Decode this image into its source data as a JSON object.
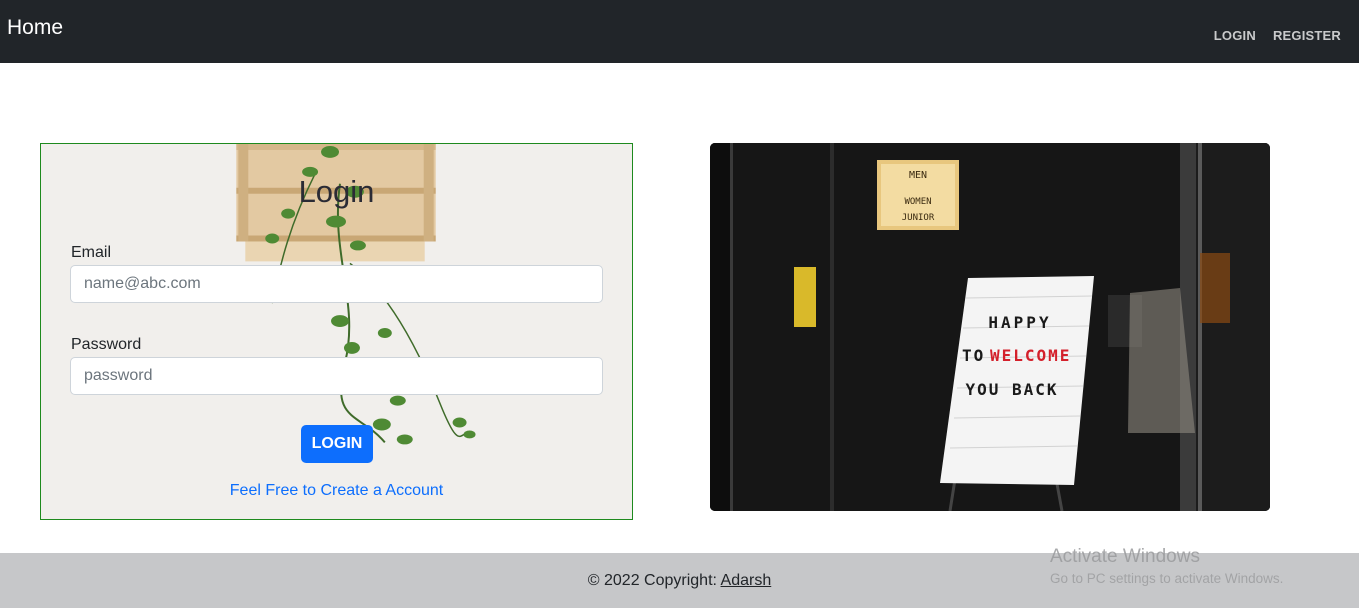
{
  "navbar": {
    "brand": "Home",
    "links": [
      "LOGIN",
      "REGISTER"
    ]
  },
  "login_form": {
    "title": "Login",
    "email_label": "Email",
    "email_placeholder": "name@abc.com",
    "email_value": "",
    "password_label": "Password",
    "password_placeholder": "password",
    "password_value": "",
    "submit_label": "LOGIN",
    "create_account_link": "Feel Free to Create a Account"
  },
  "store_image": {
    "sign_top": [
      "MEN",
      "WOMEN",
      "JUNIOR"
    ],
    "board_line_1": "HAPPY",
    "board_line_2_prefix": "TO",
    "board_line_2_highlight": "WELCOME",
    "board_line_3": "YOU BACK"
  },
  "footer": {
    "copyright": "© 2022 Copyright: ",
    "author": "Adarsh"
  },
  "watermark": {
    "title": "Activate Windows",
    "subtitle": "Go to PC settings to activate Windows."
  },
  "colors": {
    "navbar_bg": "#212529",
    "primary": "#0d6efd",
    "card_border": "#1e8a1e",
    "footer_bg": "#c6c7c9"
  }
}
